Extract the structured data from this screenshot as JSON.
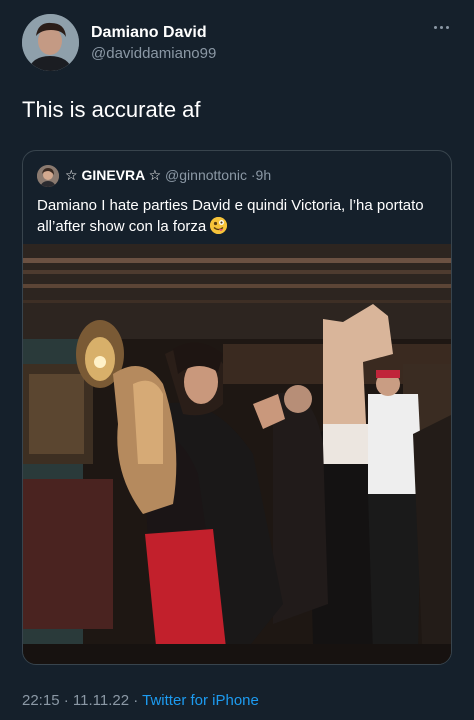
{
  "tweet": {
    "author_name": "Damiano David",
    "author_handle": "@daviddamiano99",
    "text": "This is accurate af",
    "more_icon": "more-dots-icon"
  },
  "quoted_tweet": {
    "author_name": "☆ GINEVRA ☆",
    "author_handle": "@ginnottonic",
    "separator": "·",
    "age": "9h",
    "text": "Damiano I hate parties David e quindi Victoria, l’ha portato all’after show con la forza",
    "emoji": "zany-face-emoji"
  },
  "footer": {
    "time": "22:15",
    "separator": "·",
    "date": "11.11.22",
    "source": "Twitter for iPhone"
  },
  "colors": {
    "background": "#15202b",
    "secondary_text": "#8b98a5",
    "link": "#1d9bf0",
    "border": "#38444d"
  }
}
